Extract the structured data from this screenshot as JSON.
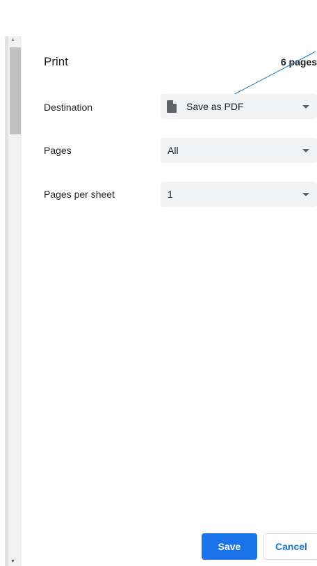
{
  "background_text": "· · · · · · · · · · · · · · · · · · · ·",
  "dialog": {
    "title": "Print",
    "page_count": "6 pages"
  },
  "fields": {
    "destination": {
      "label": "Destination",
      "value": "Save as PDF",
      "icon": "document-icon"
    },
    "pages": {
      "label": "Pages",
      "value": "All"
    },
    "pages_per_sheet": {
      "label": "Pages per sheet",
      "value": "1"
    }
  },
  "buttons": {
    "save": "Save",
    "cancel": "Cancel"
  },
  "scrollbar": {
    "up_arrow": "▲",
    "down_arrow": "▼"
  },
  "colors": {
    "accent": "#1a73e8",
    "select_bg": "#f1f3f4",
    "annotation_line": "#1f78c8"
  }
}
